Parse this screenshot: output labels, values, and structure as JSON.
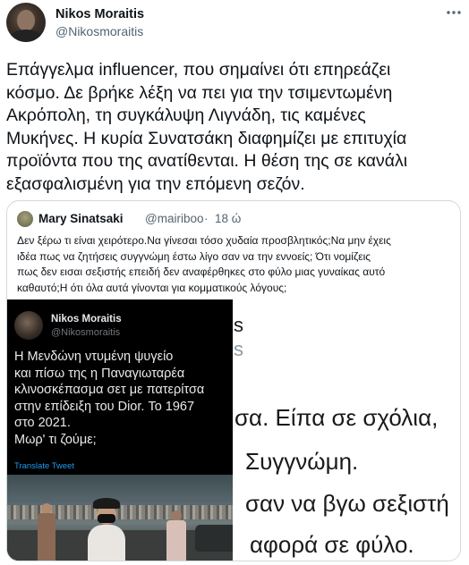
{
  "tweet": {
    "author_name": "Nikos Moraitis",
    "author_handle": "@Nikosmoraitis",
    "more_icon": "more-horizontal-icon",
    "text_lines": [
      "Επάγγελμα influencer, που σημαίνει ότι επηρεάζει",
      "κόσμο. Δε βρήκε λέξη να πει για την τσιμεντωμένη",
      "Ακρόπολη, τη συγκάλυψη Λιγνάδη, τις καμένες",
      "Μυκήνες. Η κυρία Συνατσάκη διαφημίζει με επιτυχία",
      "προϊόντα που της ανατίθενται. Η θέση της σε κανάλι",
      "εξασφαλισμένη για την επόμενη σεζόν."
    ]
  },
  "quoted": {
    "author_name": "Mary Sinatsaki",
    "author_handle": "@mairiboo",
    "separator": "·",
    "time": "18 ώ",
    "text_lines": [
      "Δεν ξέρω τι είναι χειρότερο.Να γίνεσαι τόσο χυδαία προσβλητικός;Να μην έχεις",
      "ιδέα πως να ζητήσεις συγγνώμη έστω λίγο σαν να την εννοείς; Ότι νομίζεις",
      "πως δεν εισαι σεξιστής επειδή δεν αναφέρθηκες στο φύλο μιας γυναίκας αυτό",
      "καθαυτό;Η ότι όλα αυτά γίνονται για κομματικούς λόγους;"
    ],
    "image": {
      "embedded_tweet": {
        "author_name": "Nikos Moraitis",
        "author_handle": "@Nikosmoraitis",
        "text_lines": [
          "Η Μενδώνη ντυμένη ψυγείο",
          "και πίσω της η Παναγιωταρέα",
          "κλινοσκέπασμα σετ με πατερίτσα",
          "στην επίδειξη του Dior. Το 1967",
          "στο 2021.",
          "Μωρ' τι ζούμε;"
        ],
        "translate_label": "Translate Tweet"
      },
      "background_fragments": [
        "s",
        "s",
        "σα. Είπα σε σχόλια,",
        "Συγγνώμη.",
        "σαν να βγω σεξιστή",
        "αφορά σε φύλο."
      ]
    }
  }
}
